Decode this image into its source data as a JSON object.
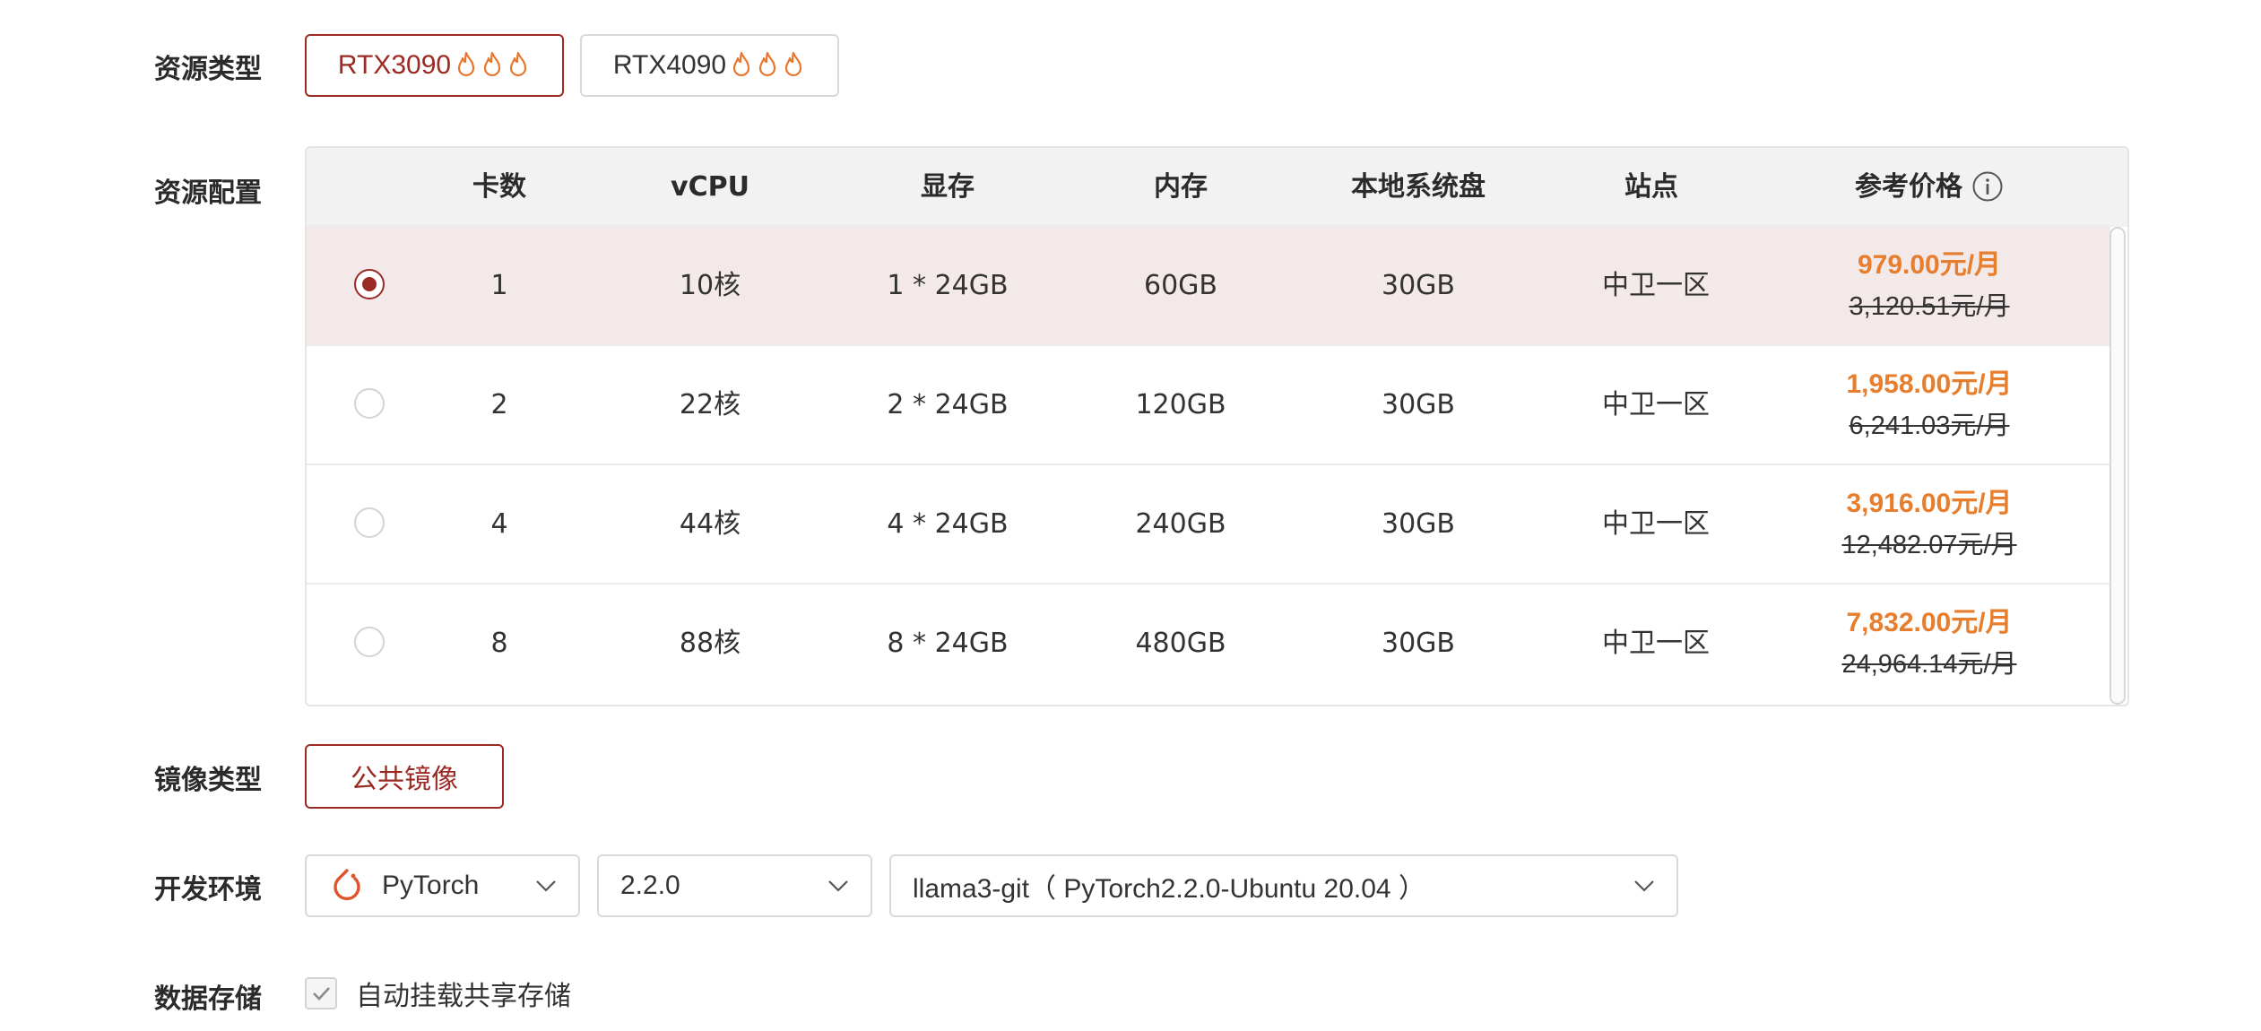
{
  "resource_type": {
    "label": "资源类型",
    "options": [
      {
        "name": "RTX3090",
        "selected": true
      },
      {
        "name": "RTX4090",
        "selected": false
      }
    ],
    "hot_icon": "flame-icon"
  },
  "resource_config": {
    "label": "资源配置",
    "columns": [
      "卡数",
      "vCPU",
      "显存",
      "内存",
      "本地系统盘",
      "站点",
      "参考价格"
    ],
    "price_info_icon": "info-icon",
    "rows": [
      {
        "selected": true,
        "cards": "1",
        "vcpu": "10核",
        "gpu_mem": "1 * 24GB",
        "mem": "60GB",
        "disk": "30GB",
        "site": "中卫一区",
        "price": "979.00元/月",
        "original_price": "3,120.51元/月"
      },
      {
        "selected": false,
        "cards": "2",
        "vcpu": "22核",
        "gpu_mem": "2 * 24GB",
        "mem": "120GB",
        "disk": "30GB",
        "site": "中卫一区",
        "price": "1,958.00元/月",
        "original_price": "6,241.03元/月"
      },
      {
        "selected": false,
        "cards": "4",
        "vcpu": "44核",
        "gpu_mem": "4 * 24GB",
        "mem": "240GB",
        "disk": "30GB",
        "site": "中卫一区",
        "price": "3,916.00元/月",
        "original_price": "12,482.07元/月"
      },
      {
        "selected": false,
        "cards": "8",
        "vcpu": "88核",
        "gpu_mem": "8 * 24GB",
        "mem": "480GB",
        "disk": "30GB",
        "site": "中卫一区",
        "price": "7,832.00元/月",
        "original_price": "24,964.14元/月"
      }
    ]
  },
  "image_type": {
    "label": "镜像类型",
    "selected": "公共镜像"
  },
  "dev_env": {
    "label": "开发环境",
    "framework": "PyTorch",
    "framework_icon": "pytorch-icon",
    "version": "2.2.0",
    "image": "llama3-git（ PyTorch2.2.0-Ubuntu 20.04 ）"
  },
  "storage": {
    "label": "数据存储",
    "auto_mount_label": "自动挂载共享存储",
    "auto_mount_checked": true
  },
  "colors": {
    "accent": "#9b2a25",
    "price": "#e67e2e",
    "selected_row_bg": "#f3e9e9",
    "header_bg": "#f2f2f2",
    "flame": "#e8772e"
  }
}
